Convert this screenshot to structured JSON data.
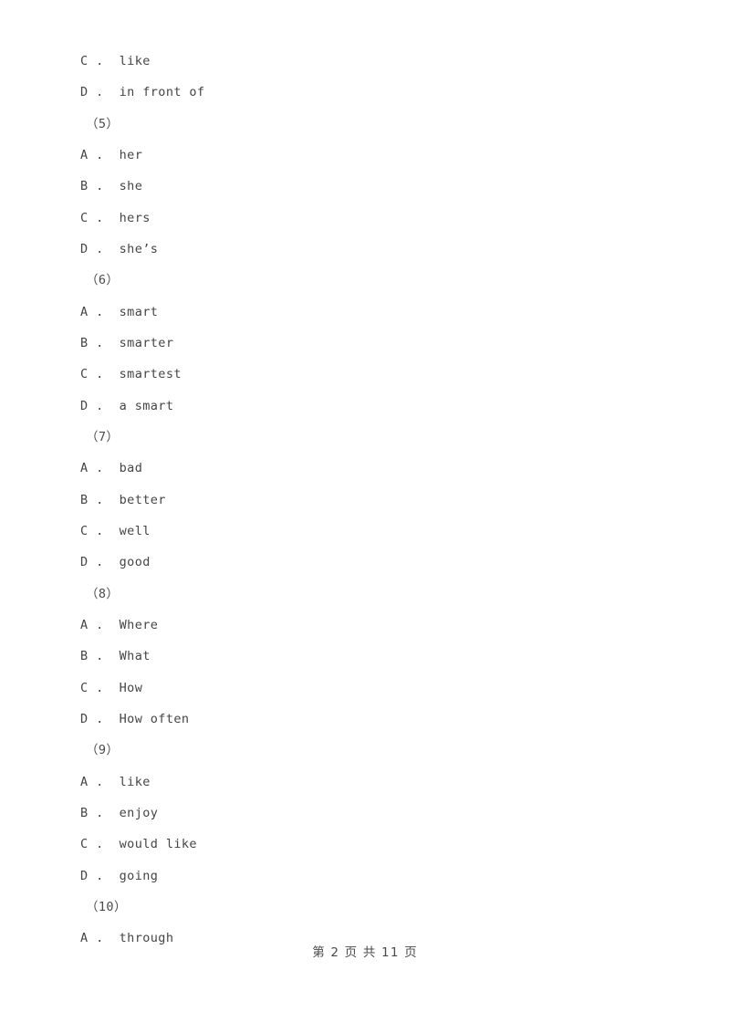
{
  "document": {
    "page_background": "#ffffff",
    "text_color": "#454545",
    "lines": [
      {
        "kind": "option",
        "letter": "C",
        "separator": ".",
        "text": "like"
      },
      {
        "kind": "option",
        "letter": "D",
        "separator": ".",
        "text": "in front of"
      },
      {
        "kind": "question_number",
        "text": "（5）"
      },
      {
        "kind": "option",
        "letter": "A",
        "separator": ".",
        "text": "her"
      },
      {
        "kind": "option",
        "letter": "B",
        "separator": ".",
        "text": "she"
      },
      {
        "kind": "option",
        "letter": "C",
        "separator": ".",
        "text": "hers"
      },
      {
        "kind": "option",
        "letter": "D",
        "separator": ".",
        "text": "she’s"
      },
      {
        "kind": "question_number",
        "text": "（6）"
      },
      {
        "kind": "option",
        "letter": "A",
        "separator": ".",
        "text": "smart"
      },
      {
        "kind": "option",
        "letter": "B",
        "separator": ".",
        "text": "smarter"
      },
      {
        "kind": "option",
        "letter": "C",
        "separator": ".",
        "text": "smartest"
      },
      {
        "kind": "option",
        "letter": "D",
        "separator": ".",
        "text": "a smart"
      },
      {
        "kind": "question_number",
        "text": "（7）"
      },
      {
        "kind": "option",
        "letter": "A",
        "separator": ".",
        "text": "bad"
      },
      {
        "kind": "option",
        "letter": "B",
        "separator": ".",
        "text": "better"
      },
      {
        "kind": "option",
        "letter": "C",
        "separator": ".",
        "text": "well"
      },
      {
        "kind": "option",
        "letter": "D",
        "separator": ".",
        "text": "good"
      },
      {
        "kind": "question_number",
        "text": "（8）"
      },
      {
        "kind": "option",
        "letter": "A",
        "separator": ".",
        "text": "Where"
      },
      {
        "kind": "option",
        "letter": "B",
        "separator": ".",
        "text": "What"
      },
      {
        "kind": "option",
        "letter": "C",
        "separator": ".",
        "text": "How"
      },
      {
        "kind": "option",
        "letter": "D",
        "separator": ".",
        "text": "How often"
      },
      {
        "kind": "question_number",
        "text": "（9）"
      },
      {
        "kind": "option",
        "letter": "A",
        "separator": ".",
        "text": "like"
      },
      {
        "kind": "option",
        "letter": "B",
        "separator": ".",
        "text": "enjoy"
      },
      {
        "kind": "option",
        "letter": "C",
        "separator": ".",
        "text": "would like"
      },
      {
        "kind": "option",
        "letter": "D",
        "separator": ".",
        "text": "going"
      },
      {
        "kind": "question_number",
        "text": "（10）"
      },
      {
        "kind": "option",
        "letter": "A",
        "separator": ".",
        "text": "through"
      }
    ]
  },
  "footer": {
    "text": "第 2 页 共 11 页",
    "current_page": "2",
    "total_pages": "11"
  }
}
